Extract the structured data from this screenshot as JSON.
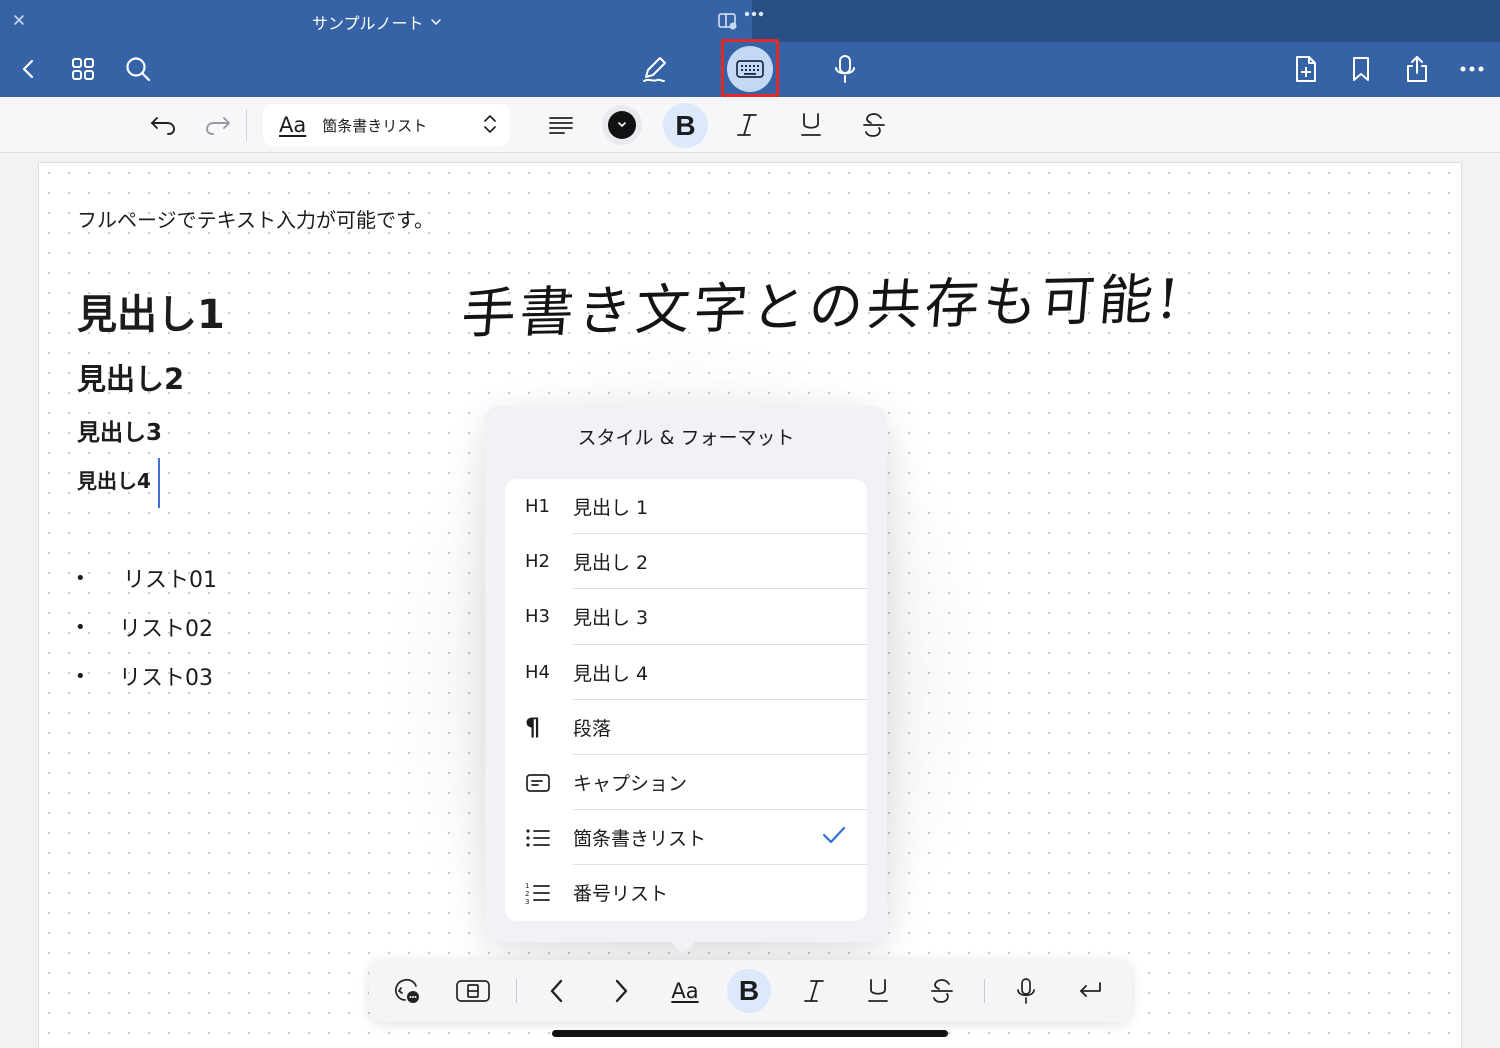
{
  "titlebar": {
    "title": "サンプルノート",
    "close_icon": "close-icon",
    "menu_icon": "chevron-down-icon"
  },
  "main_toolbar": {
    "left": [
      "back-icon",
      "grid-icon",
      "search-icon"
    ],
    "center": [
      "pen-icon",
      "keyboard-icon",
      "microphone-icon"
    ],
    "right": [
      "add-page-icon",
      "bookmark-icon",
      "share-icon",
      "more-icon"
    ],
    "highlight_color": "#e02a2a"
  },
  "format_bar": {
    "style_prefix": "Aa",
    "style_value": "箇条書きリスト",
    "bold": "B",
    "italic": "I",
    "underline": "U",
    "strike": "S",
    "text_color": "#111111"
  },
  "note": {
    "intro": "フルページでテキスト入力が可能です。",
    "heading1": "見出し1",
    "heading2": "見出し2",
    "heading3": "見出し3",
    "heading4": "見出し4",
    "list": [
      {
        "bullet": "•",
        "text": "リスト01"
      },
      {
        "bullet": "•",
        "text": "リスト02"
      },
      {
        "bullet": "•",
        "text": "リスト03"
      }
    ],
    "handwriting": "手書き文字との共存も可能!"
  },
  "popover": {
    "title": "スタイル & フォーマット",
    "items": [
      {
        "lead": "H1",
        "label": "見出し 1"
      },
      {
        "lead": "H2",
        "label": "見出し 2"
      },
      {
        "lead": "H3",
        "label": "見出し 3"
      },
      {
        "lead": "H4",
        "label": "見出し 4"
      },
      {
        "lead": "¶",
        "label": "段落"
      },
      {
        "lead": "caption-icon",
        "label": "キャプション"
      },
      {
        "lead": "bullet-list-icon",
        "label": "箇条書きリスト",
        "selected": true
      },
      {
        "lead": "numbered-list-icon",
        "label": "番号リスト"
      }
    ],
    "check_color": "#2f6fd6"
  },
  "bottom_bar": {
    "aa": "Aa",
    "bold": "B",
    "italic": "I",
    "underline": "U",
    "strike": "S",
    "accent": "#dce9fb"
  }
}
